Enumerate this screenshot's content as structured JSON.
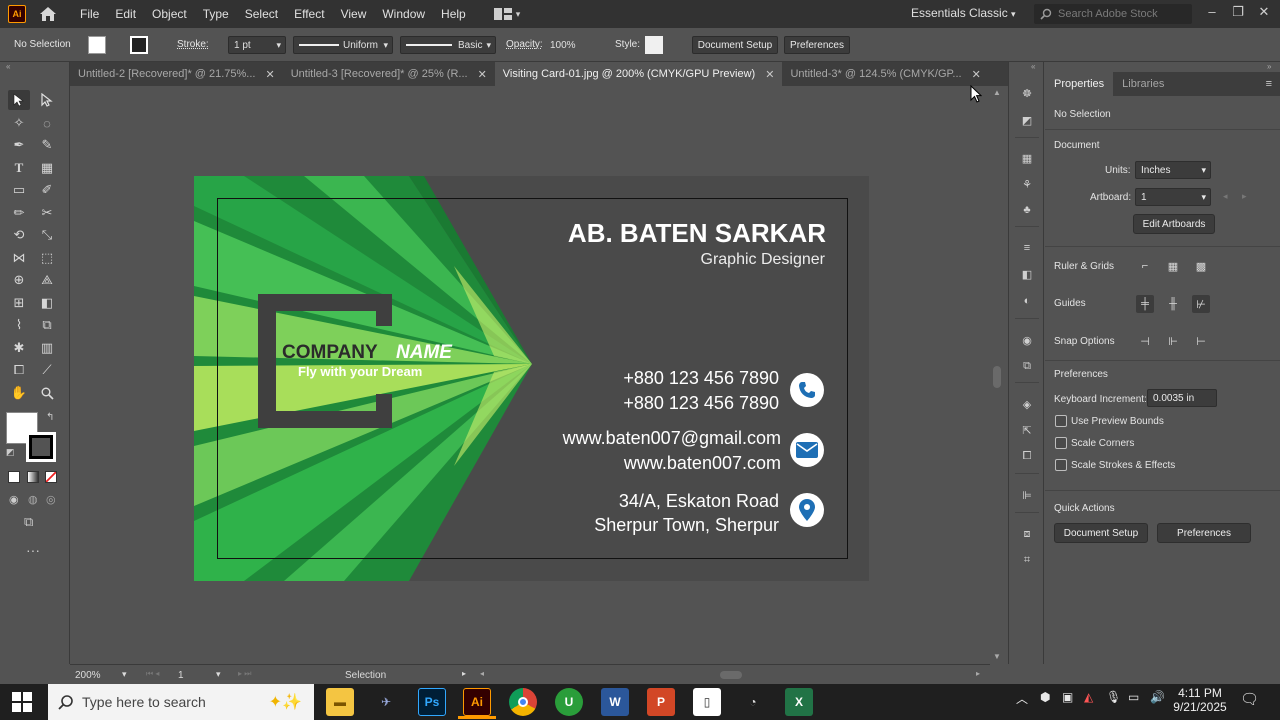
{
  "app": {
    "logo_text": "Ai",
    "menu": [
      "File",
      "Edit",
      "Object",
      "Type",
      "Select",
      "Effect",
      "View",
      "Window",
      "Help"
    ],
    "workspace": "Essentials Classic",
    "search_placeholder": "Search Adobe Stock"
  },
  "controlbar": {
    "selection": "No Selection",
    "stroke_label": "Stroke:",
    "stroke_value": "1 pt",
    "stroke_profile": "Uniform",
    "brush": "Basic",
    "opacity_label": "Opacity:",
    "opacity_value": "100%",
    "style_label": "Style:",
    "document_setup": "Document Setup",
    "preferences": "Preferences"
  },
  "tabs": [
    {
      "label": "Untitled-2 [Recovered]* @ 21.75%...",
      "active": false
    },
    {
      "label": "Untitled-3 [Recovered]* @ 25% (R...",
      "active": false
    },
    {
      "label": "Visiting Card-01.jpg @ 200% (CMYK/GPU Preview)",
      "active": true
    },
    {
      "label": "Untitled-3* @ 124.5% (CMYK/GP...",
      "active": false
    }
  ],
  "card": {
    "name": "AB. BATEN SARKAR",
    "title": "Graphic Designer",
    "company_part1": "COMPANY",
    "company_part2": "NAME",
    "tagline": "Fly with your Dream",
    "phone1": "+880 123 456 7890",
    "phone2": "+880 123 456 7890",
    "email": "www.baten007@gmail.com",
    "website": "www.baten007.com",
    "address1": "34/A, Eskaton Road",
    "address2": "Sherpur Town, Sherpur",
    "colors": {
      "green_dark": "#1e7e34",
      "green_mid": "#2fa33f",
      "green_light": "#8fd14f",
      "lime": "#b5e04a",
      "card_bg": "#4a4a4a",
      "icon_blue": "#1e6fb5"
    }
  },
  "panel": {
    "tabs": [
      "Properties",
      "Libraries"
    ],
    "selection": "No Selection",
    "document_heading": "Document",
    "units_label": "Units:",
    "units_value": "Inches",
    "artboard_label": "Artboard:",
    "artboard_value": "1",
    "edit_artboards": "Edit Artboards",
    "ruler_grids": "Ruler & Grids",
    "guides": "Guides",
    "snap_options": "Snap Options",
    "preferences_heading": "Preferences",
    "keyboard_increment_label": "Keyboard Increment:",
    "keyboard_increment_value": "0.0035 in",
    "use_preview_bounds": "Use Preview Bounds",
    "scale_corners": "Scale Corners",
    "scale_strokes": "Scale Strokes & Effects",
    "quick_actions": "Quick Actions",
    "document_setup": "Document Setup",
    "preferences": "Preferences"
  },
  "statusbar": {
    "zoom": "200%",
    "artboard": "1",
    "tool": "Selection"
  },
  "taskbar": {
    "search_placeholder": "Type here to search",
    "time": "4:11 PM",
    "date": "9/21/2025"
  }
}
